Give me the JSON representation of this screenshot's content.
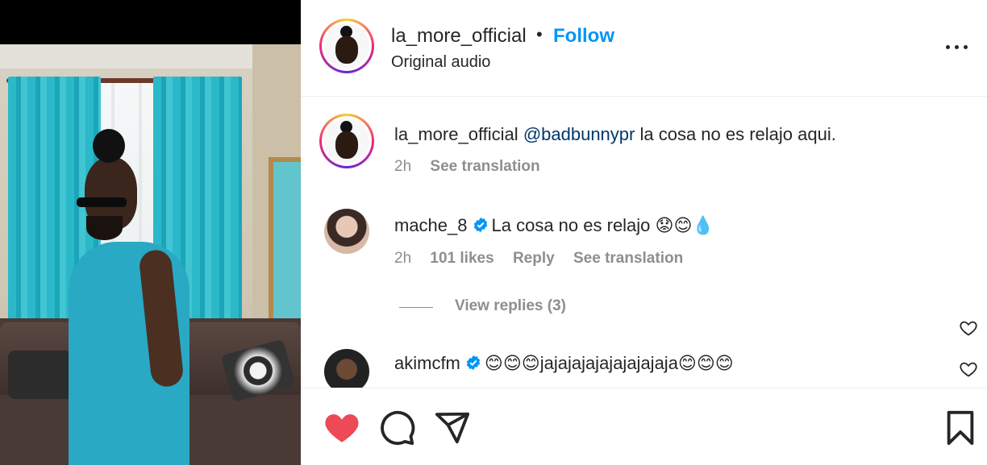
{
  "post": {
    "username": "la_more_official",
    "separator": "•",
    "follow_label": "Follow",
    "audio_label": "Original audio",
    "more_label": "More options"
  },
  "caption": {
    "username": "la_more_official",
    "mention": "@badbunnypr",
    "text": " la cosa no es relajo aqui.",
    "time": "2h",
    "translate_label": "See translation"
  },
  "comments": [
    {
      "username": "mache_8",
      "verified": true,
      "text": "La cosa no es relajo 😟😊💧",
      "time": "2h",
      "likes": "101 likes",
      "reply_label": "Reply",
      "translate_label": "See translation",
      "view_replies": "View replies (3)"
    },
    {
      "username": "akimcfm",
      "verified": true,
      "text": "😊😊😊jajajajajajajajajaja😊😊😊"
    }
  ],
  "actions": {
    "like": "heart-icon",
    "comment": "comment-icon",
    "share": "send-icon",
    "save": "bookmark-icon",
    "liked_color": "#ed4956"
  },
  "colors": {
    "follow": "#0095f6",
    "verified": "#0095f6",
    "muted": "#8e8e8e",
    "mention": "#00376b"
  }
}
